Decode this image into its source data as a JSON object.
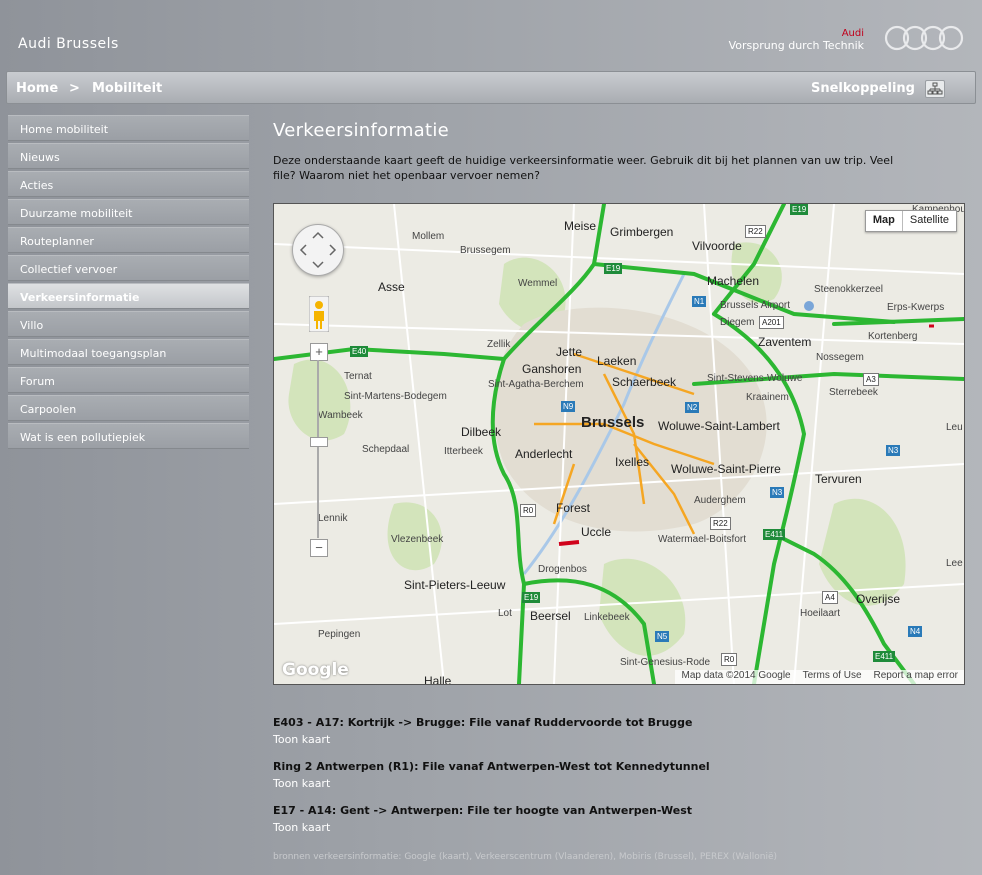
{
  "header": {
    "site_title": "Audi Brussels",
    "brand_name": "Audi",
    "brand_tagline": "Vorsprung durch Technik"
  },
  "breadcrumb": {
    "home": "Home",
    "separator": ">",
    "current": "Mobiliteit",
    "shortcut": "Snelkoppeling"
  },
  "sidebar": {
    "items": [
      {
        "label": "Home mobiliteit"
      },
      {
        "label": "Nieuws"
      },
      {
        "label": "Acties"
      },
      {
        "label": "Duurzame mobiliteit"
      },
      {
        "label": "Routeplanner"
      },
      {
        "label": "Collectief vervoer"
      },
      {
        "label": "Verkeersinformatie",
        "active": true
      },
      {
        "label": "Villo"
      },
      {
        "label": "Multimodaal toegangsplan"
      },
      {
        "label": "Forum"
      },
      {
        "label": "Carpoolen"
      },
      {
        "label": "Wat is een pollutiepiek"
      }
    ]
  },
  "main": {
    "title": "Verkeersinformatie",
    "intro": "Deze onderstaande kaart geeft de huidige verkeersinformatie weer. Gebruik dit bij het plannen van uw trip. Veel file? Waarom niet het openbaar vervoer nemen?"
  },
  "map": {
    "type_map": "Map",
    "type_satellite": "Satellite",
    "zoom_in": "+",
    "zoom_out": "−",
    "logo": "Google",
    "footer_data": "Map data ©2014 Google",
    "footer_terms": "Terms of Use",
    "footer_report": "Report a map error",
    "labels": {
      "brussels": "Brussels",
      "schaerbeek": "Schaerbeek",
      "anderlecht": "Anderlecht",
      "ixelles": "Ixelles",
      "woluwe_lambert": "Woluwe-Saint-Lambert",
      "woluwe_pierre": "Woluwe-Saint-Pierre",
      "vilvoorde": "Vilvoorde",
      "grimbergen": "Grimbergen",
      "meise": "Meise",
      "mollem": "Mollem",
      "brussegem": "Brussegem",
      "asse": "Asse",
      "wemmel": "Wemmel",
      "machelen": "Machelen",
      "steenokkerzeel": "Steenokkerzeel",
      "erps_kwerps": "Erps-Kwerps",
      "kortenberg": "Kortenberg",
      "airport": "Brussels Airport",
      "diegem": "Diegem",
      "zaventem": "Zaventem",
      "nossegem": "Nossegem",
      "zellik": "Zellik",
      "jette": "Jette",
      "laeken": "Laeken",
      "ganshoren": "Ganshoren",
      "ternat": "Ternat",
      "agatha": "Sint-Agatha-Berchem",
      "stevens": "Sint-Stevens-Woluwe",
      "sterrebeek": "Sterrebeek",
      "kraainem": "Kraainem",
      "martens": "Sint-Martens-Bodegem",
      "wambeek": "Wambeek",
      "dilbeek": "Dilbeek",
      "schepdaal": "Schepdaal",
      "itterbeek": "Itterbeek",
      "tervuren": "Tervuren",
      "auderghem": "Auderghem",
      "forest": "Forest",
      "uccle": "Uccle",
      "watermael": "Watermael-Boitsfort",
      "lennik": "Lennik",
      "vlezenbeek": "Vlezenbeek",
      "drogenbos": "Drogenbos",
      "pieters": "Sint-Pieters-Leeuw",
      "overijse": "Overijse",
      "hoeilaart": "Hoeilaart",
      "lot": "Lot",
      "beersel": "Beersel",
      "linkebeek": "Linkebeek",
      "pepingen": "Pepingen",
      "genesius": "Sint-Genesius-Rode",
      "halle": "Halle",
      "kampenhout": "Kampenhout",
      "leu": "Leu",
      "lee": "Lee"
    },
    "shields": {
      "e19a": "E19",
      "e19b": "E19",
      "e19c": "E19",
      "r22a": "R22",
      "r22b": "R22",
      "n1": "N1",
      "a201": "A201",
      "e40": "E40",
      "a3": "A3",
      "n9": "N9",
      "n2": "N2",
      "n3": "N3",
      "r0a": "R0",
      "r0b": "R0",
      "e411a": "E411",
      "e411b": "E411",
      "a4": "A4",
      "n4": "N4",
      "n5": "N5"
    }
  },
  "reports": [
    {
      "title": "E403 - A17: Kortrijk -> Brugge: File vanaf Ruddervoorde tot Brugge",
      "link": "Toon kaart"
    },
    {
      "title": "Ring 2 Antwerpen (R1): File vanaf Antwerpen-West tot Kennedytunnel",
      "link": "Toon kaart"
    },
    {
      "title": "E17 - A14: Gent -> Antwerpen: File ter hoogte van Antwerpen-West",
      "link": "Toon kaart"
    }
  ],
  "sources": "bronnen verkeersinformatie: Google (kaart), Verkeerscentrum (Vlaanderen), Mobiris (Brussel), PEREX (Wallonië)",
  "colors": {
    "traffic_free": "#2cb732",
    "traffic_slow": "#f5a623",
    "traffic_jam": "#d0021b",
    "accent_red": "#c0001b"
  }
}
